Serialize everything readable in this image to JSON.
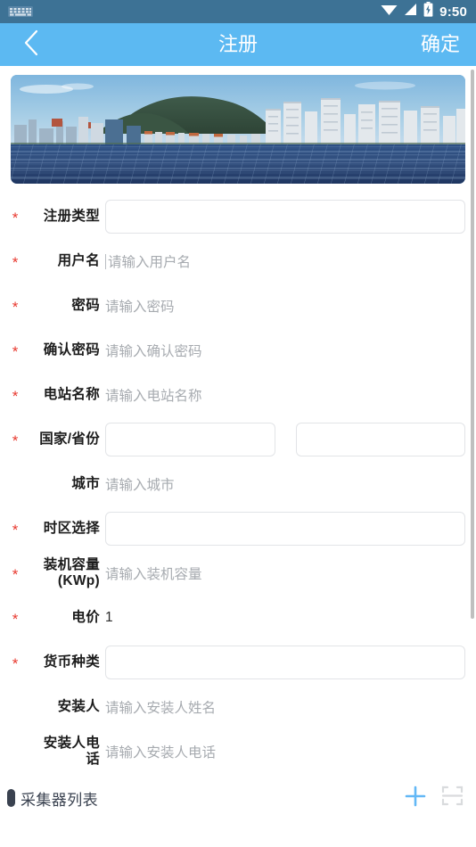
{
  "statusbar": {
    "keyboard_icon": "keyboard-icon",
    "wifi_icon": "wifi-icon",
    "signal_icon": "signal-icon",
    "battery_icon": "battery-charging-icon",
    "time": "9:50"
  },
  "appbar": {
    "back_icon": "chevron-left-icon",
    "title": "注册",
    "action_label": "确定"
  },
  "banner": {
    "alt": "solar-panel-farm-photo"
  },
  "colors": {
    "statusbar_bg": "#3D7295",
    "appbar_bg": "#5CB9F2",
    "required_star": "#e8392f",
    "placeholder": "#a7abb0",
    "label": "#1c1c1c",
    "accent_add": "#63B8F6",
    "section_title": "#3a4250",
    "input_border": "#e2e4e7"
  },
  "form": {
    "rows": [
      {
        "name": "register-type",
        "required": true,
        "label": "注册类型",
        "control": "input-box",
        "value": "",
        "placeholder": ""
      },
      {
        "name": "username",
        "required": true,
        "label": "用户名",
        "control": "text",
        "value": "",
        "placeholder": "请输入用户名",
        "focused": true
      },
      {
        "name": "password",
        "required": true,
        "label": "密码",
        "control": "text",
        "value": "",
        "placeholder": "请输入密码"
      },
      {
        "name": "confirm-password",
        "required": true,
        "label": "确认密码",
        "control": "text",
        "value": "",
        "placeholder": "请输入确认密码"
      },
      {
        "name": "plant-name",
        "required": true,
        "label": "电站名称",
        "control": "text",
        "value": "",
        "placeholder": "请输入电站名称"
      },
      {
        "name": "country-province",
        "required": true,
        "label": "国家/省份",
        "control": "input-box-pair",
        "value": "",
        "value2": "",
        "placeholder": "",
        "placeholder2": ""
      },
      {
        "name": "city",
        "required": false,
        "label": "城市",
        "control": "text",
        "value": "",
        "placeholder": "请输入城市"
      },
      {
        "name": "timezone",
        "required": true,
        "label": "时区选择",
        "control": "input-box",
        "value": "",
        "placeholder": ""
      },
      {
        "name": "installed-capacity",
        "required": true,
        "label": "装机容量",
        "label_sub": "(KWp)",
        "control": "text",
        "value": "",
        "placeholder": "请输入装机容量"
      },
      {
        "name": "electricity-price",
        "required": true,
        "label": "电价",
        "control": "text",
        "value": "1",
        "placeholder": ""
      },
      {
        "name": "currency-type",
        "required": true,
        "label": "货币种类",
        "control": "input-box",
        "value": "",
        "placeholder": ""
      },
      {
        "name": "installer",
        "required": false,
        "label": "安装人",
        "control": "text",
        "value": "",
        "placeholder": "请输入安装人姓名"
      },
      {
        "name": "installer-phone",
        "required": false,
        "label": "安装人电话",
        "control": "text",
        "value": "",
        "placeholder": "请输入安装人电话"
      }
    ]
  },
  "collector_section": {
    "title": "采集器列表",
    "add_icon": "plus-icon",
    "scan_icon": "scan-qr-icon"
  }
}
